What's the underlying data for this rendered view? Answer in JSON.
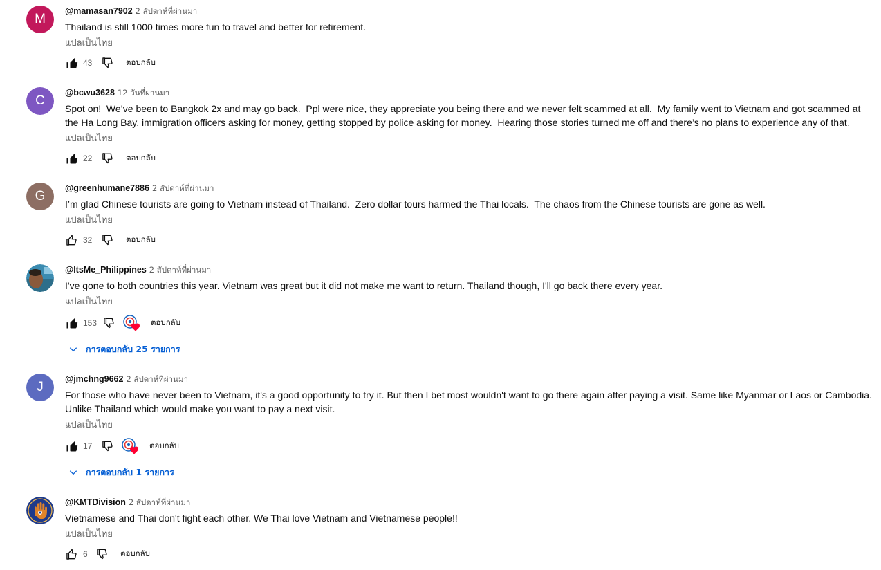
{
  "translate_label": "แปลเป็นไทย",
  "reply_label": "ตอบกลับ",
  "comments": [
    {
      "avatar_letter": "M",
      "avatar_color": "#c2185b",
      "author": "@mamasan7902",
      "time": "2 สัปดาห์ที่ผ่านมา",
      "text": "Thailand is still 1000 times more fun to travel and better for retirement.",
      "likes": "43",
      "liked": true
    },
    {
      "avatar_letter": "C",
      "avatar_color": "#7e57c2",
      "author": "@bcwu3628",
      "time": "12 วันที่ผ่านมา",
      "text": "Spot on!  We’ve been to Bangkok 2x and may go back.  Ppl were nice, they appreciate you being there and we never felt scammed at all.  My family went to Vietnam and got scammed at the Ha Long Bay, immigration officers asking for money, getting stopped by police asking for money.  Hearing those stories turned me off and there’s no plans to experience any of that.",
      "likes": "22",
      "liked": true
    },
    {
      "avatar_letter": "G",
      "avatar_color": "#8d6e63",
      "author": "@greenhumane7886",
      "time": "2 สัปดาห์ที่ผ่านมา",
      "text": "I’m glad Chinese tourists are going to Vietnam instead of Thailand.  Zero dollar tours harmed the Thai locals.  The chaos from the Chinese tourists are gone as well.",
      "likes": "32",
      "liked": false
    },
    {
      "avatar_letter": "",
      "avatar_color": "#4a7a8c",
      "author": "@ItsMe_Philippines",
      "time": "2 สัปดาห์ที่ผ่านมา",
      "text": "I've gone to both countries this year. Vietnam was great but it did not make me want to return. Thailand though, I'll go back there every year.",
      "likes": "153",
      "liked": true,
      "replies_label": "การตอบกลับ 25 รายการ"
    },
    {
      "avatar_letter": "J",
      "avatar_color": "#5c6bc0",
      "author": "@jmchng9662",
      "time": "2 สัปดาห์ที่ผ่านมา",
      "text": "For those who have never been to Vietnam, it's a good opportunity to try it. But then I bet most wouldn't want to go there again after paying a visit. Same like Myanmar or Laos or Cambodia. Unlike Thailand which would make you want to pay a next visit.",
      "likes": "17",
      "liked": true,
      "replies_label": "การตอบกลับ 1 รายการ"
    },
    {
      "avatar_letter": "",
      "avatar_color": "#1e3a8a",
      "author": "@KMTDivision",
      "time": "2 สัปดาห์ที่ผ่านมา",
      "text": "Vietnamese and Thai don't fight each other. We Thai love Vietnam and Vietnamese people!!",
      "likes": "6",
      "liked": false
    }
  ]
}
